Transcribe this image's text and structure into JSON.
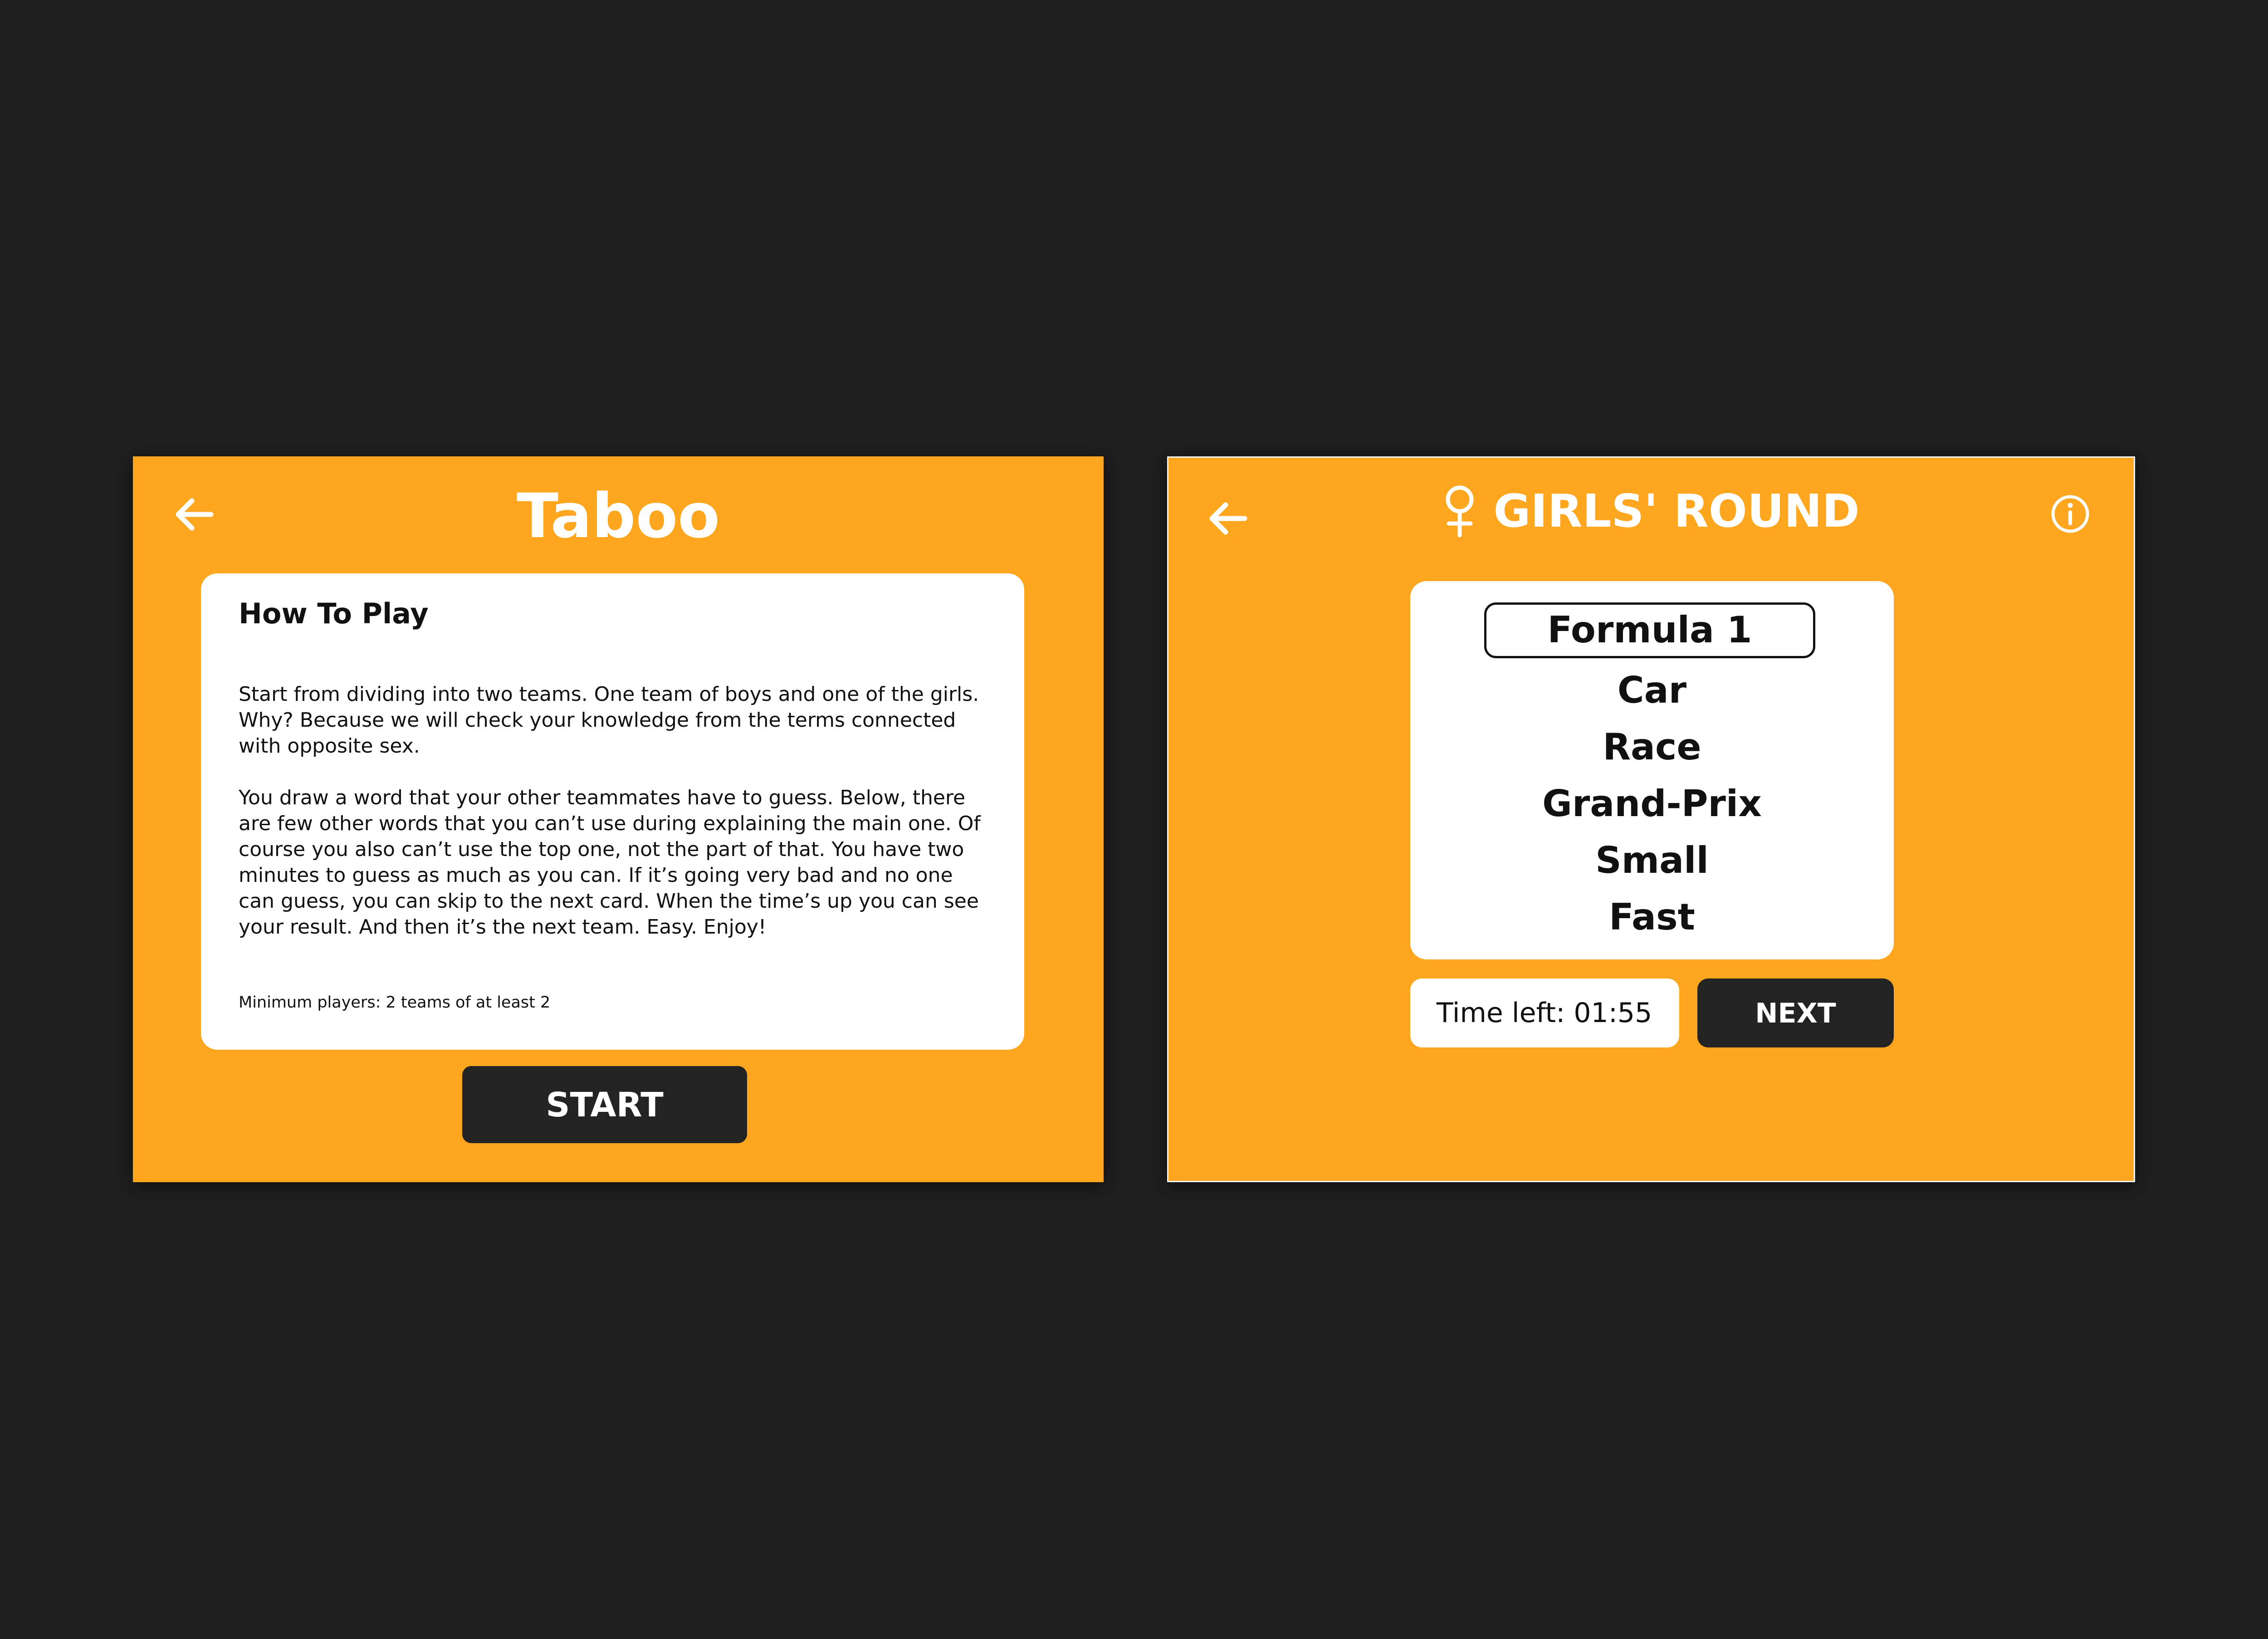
{
  "left_screen": {
    "title": "Taboo",
    "howto": {
      "heading": "How To Play",
      "paragraph_1": "Start from dividing into two teams. One team of boys and one of the girls. Why? Because we will check your knowledge from the terms connected with opposite sex.",
      "paragraph_2": "You draw a word that your other teammates have to guess. Below, there are few other words that you can’t use during explaining the main one. Of course you also can’t use the top one, not the part of that. You have two minutes to guess as much as you can. If it’s going very bad and no one can guess, you can skip to the next card. When the time’s up you can see your result. And then it’s the next team. Easy. Enjoy!",
      "min_players": "Minimum players: 2 teams of at least 2"
    },
    "start_label": "START"
  },
  "right_screen": {
    "title": "GIRLS' ROUND",
    "main_word": "Formula 1",
    "taboo_words": [
      "Car",
      "Race",
      "Grand-Prix",
      "Small",
      "Fast"
    ],
    "timer_text": "Time left: 01:55",
    "next_label": "NEXT"
  },
  "icons": {
    "back": "back-arrow-icon",
    "gender": "female-symbol-icon",
    "info": "info-icon"
  },
  "colors": {
    "background": "#1f1f1f",
    "panel": "#fea61d",
    "card": "#ffffff",
    "button": "#232323",
    "text_light": "#ffffff",
    "text_dark": "#111111"
  }
}
